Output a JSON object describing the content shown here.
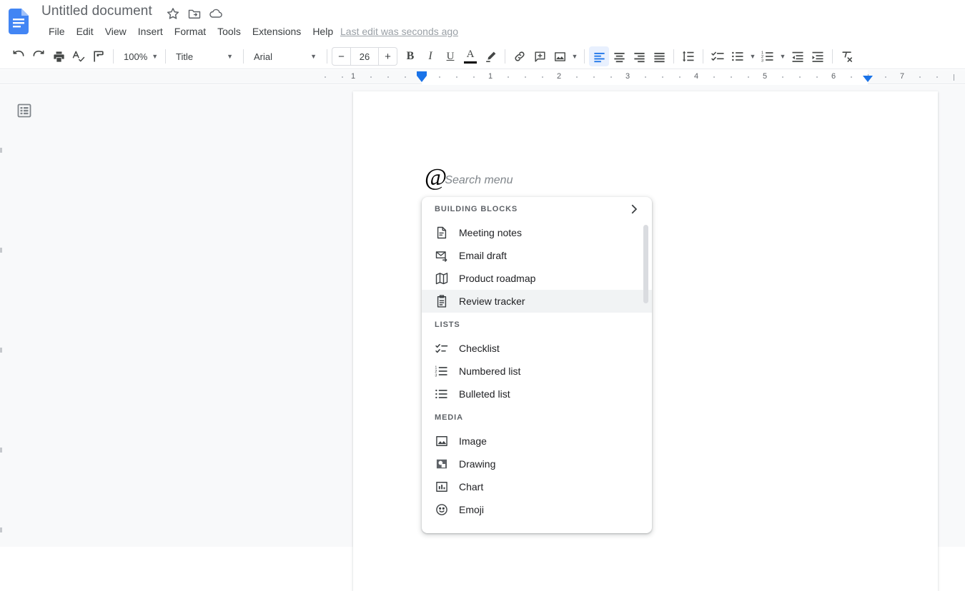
{
  "header": {
    "doc_title": "Untitled document",
    "logo_icon": "google-docs-logo",
    "title_actions": [
      {
        "name": "star-icon",
        "glyph": "star"
      },
      {
        "name": "move-to-folder-icon",
        "glyph": "folder-move"
      },
      {
        "name": "cloud-saved-icon",
        "glyph": "cloud-done"
      }
    ],
    "menus": [
      "File",
      "Edit",
      "View",
      "Insert",
      "Format",
      "Tools",
      "Extensions",
      "Help"
    ],
    "last_edit": "Last edit was seconds ago"
  },
  "toolbar": {
    "undo": "undo-icon",
    "redo": "redo-icon",
    "print": "print-icon",
    "spellcheck": "spellcheck-icon",
    "paint_format": "paint-format-icon",
    "zoom_value": "100%",
    "style_value": "Title",
    "font_value": "Arial",
    "font_size_value": "26",
    "font_size_decrease": "−",
    "font_size_increase": "+",
    "bold": "B",
    "italic": "I",
    "underline": "U",
    "text_color": "A",
    "text_color_swatch": "#000000",
    "highlight": "highlight-pen-icon",
    "insert_link": "link-icon",
    "add_comment": "add-comment-icon",
    "insert_image": "insert-image-icon",
    "align_left": "align-left-icon",
    "align_center": "align-center-icon",
    "align_right": "align-right-icon",
    "align_justify": "align-justify-icon",
    "line_spacing": "line-spacing-icon",
    "checklist": "checklist-icon",
    "bulleted_list": "bulleted-list-icon",
    "numbered_list": "numbered-list-icon",
    "decrease_indent": "decrease-indent-icon",
    "increase_indent": "increase-indent-icon",
    "clear_formatting": "clear-formatting-icon",
    "active_alignment": "align-left",
    "accent_color": "#1a73e8",
    "active_bg": "#e8f0fe"
  },
  "ruler": {
    "numbers": [
      "1",
      "1",
      "2",
      "3",
      "4",
      "5",
      "6",
      "7"
    ],
    "first_line_indent_marker": "first-line-indent-marker",
    "left_indent_marker": "left-indent-marker",
    "right_indent_marker": "right-indent-marker",
    "marker_color": "#1a73e8"
  },
  "workspace": {
    "outline_button": "document-outline-icon",
    "page": "document-page"
  },
  "at_menu": {
    "symbol": "@",
    "placeholder": "Search menu",
    "sections": [
      {
        "title": "BUILDING BLOCKS",
        "has_chevron": true,
        "chevron_icon": "chevron-right-icon",
        "items": [
          {
            "label": "Meeting notes",
            "icon": "meeting-notes-icon",
            "selected": false
          },
          {
            "label": "Email draft",
            "icon": "email-draft-icon",
            "selected": false
          },
          {
            "label": "Product roadmap",
            "icon": "product-roadmap-icon",
            "selected": false
          },
          {
            "label": "Review tracker",
            "icon": "review-tracker-icon",
            "selected": true
          }
        ]
      },
      {
        "title": "LISTS",
        "has_chevron": false,
        "items": [
          {
            "label": "Checklist",
            "icon": "checklist-icon",
            "selected": false
          },
          {
            "label": "Numbered list",
            "icon": "numbered-list-icon",
            "selected": false
          },
          {
            "label": "Bulleted list",
            "icon": "bulleted-list-icon",
            "selected": false
          }
        ]
      },
      {
        "title": "MEDIA",
        "has_chevron": false,
        "items": [
          {
            "label": "Image",
            "icon": "image-icon",
            "selected": false
          },
          {
            "label": "Drawing",
            "icon": "drawing-icon",
            "selected": false
          },
          {
            "label": "Chart",
            "icon": "chart-icon",
            "selected": false
          },
          {
            "label": "Emoji",
            "icon": "emoji-icon",
            "selected": false
          }
        ]
      }
    ]
  }
}
